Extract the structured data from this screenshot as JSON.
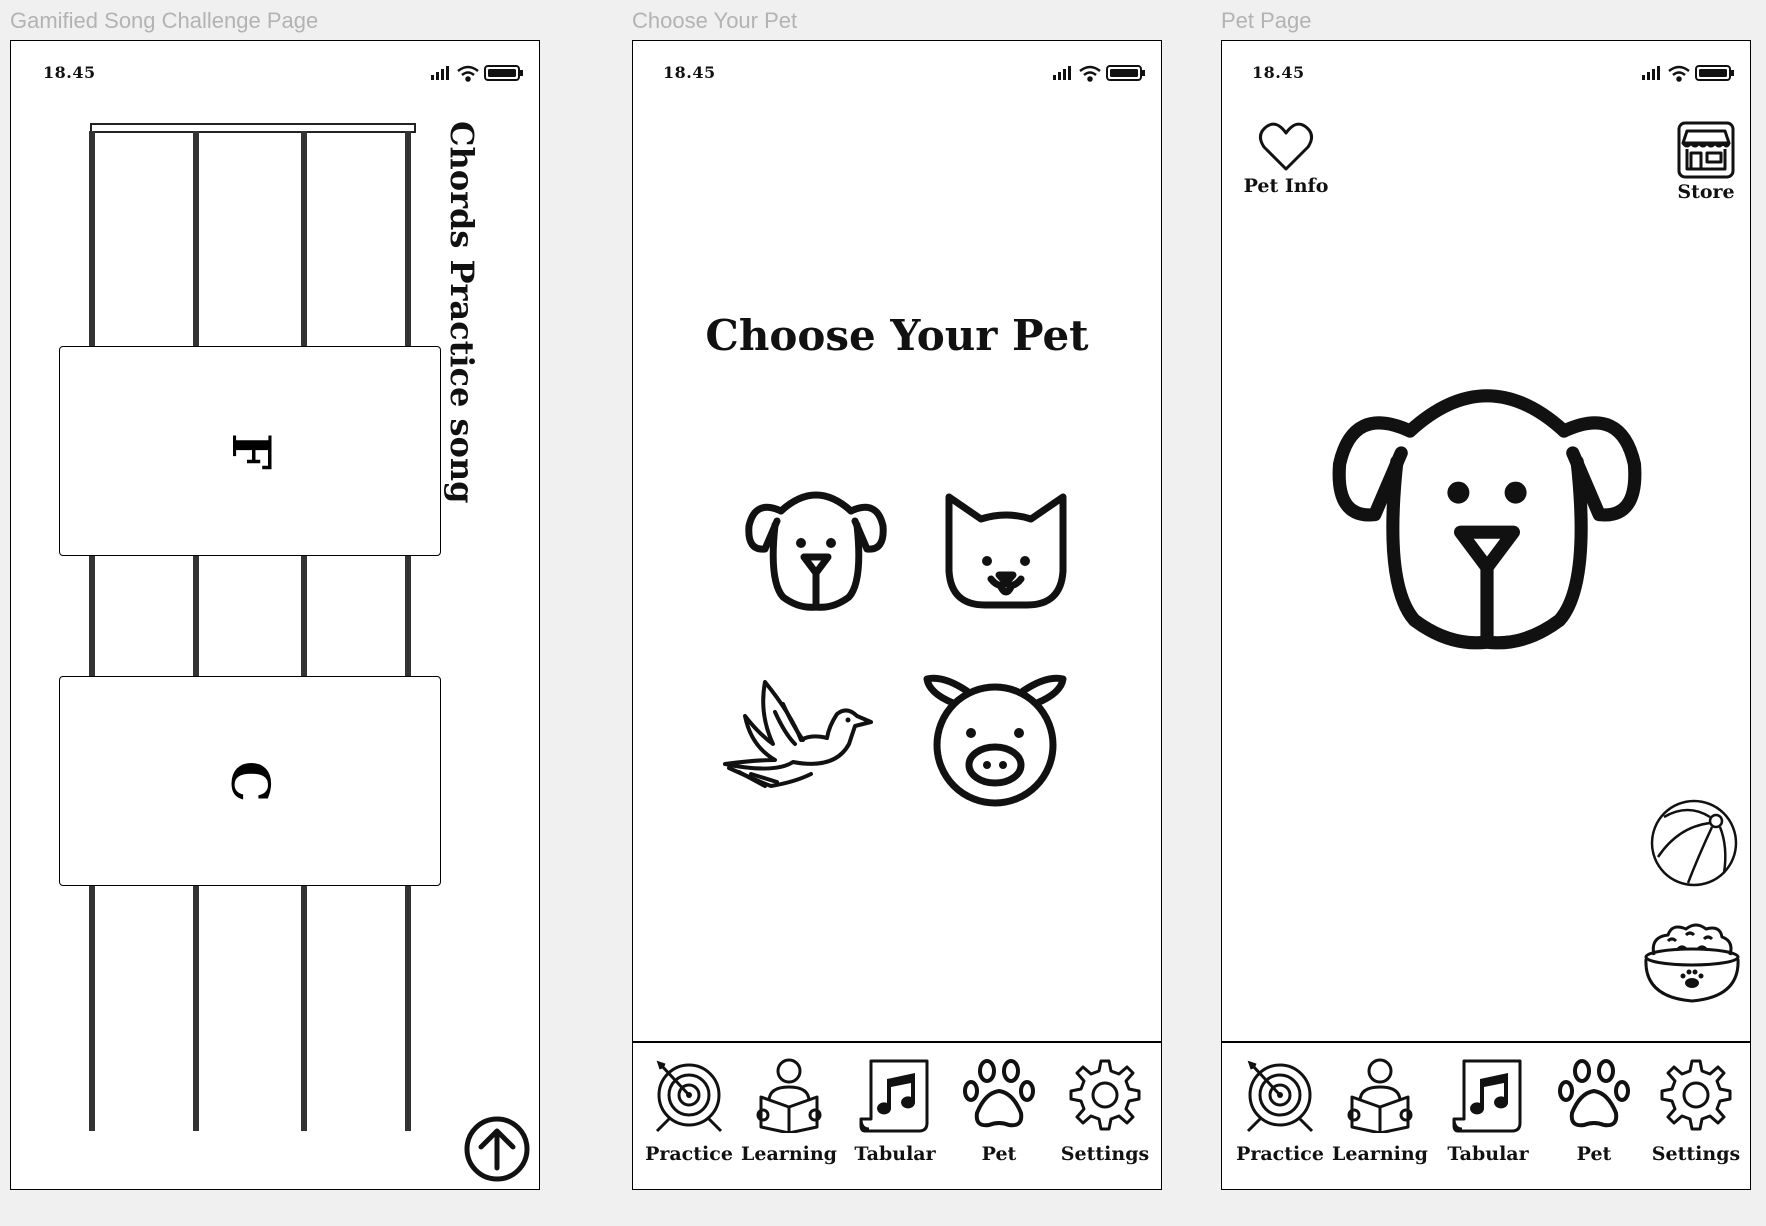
{
  "frames": [
    {
      "label": "Gamified Song Challenge Page"
    },
    {
      "label": "Choose Your Pet"
    },
    {
      "label": "Pet Page"
    }
  ],
  "status": {
    "time": "18.45"
  },
  "challenge": {
    "title": "Chords Practice song",
    "chords": [
      "F",
      "C"
    ],
    "up_icon": "arrow-up-circle-icon"
  },
  "choose": {
    "title": "Choose Your Pet",
    "pets": [
      "dog-icon",
      "cat-icon",
      "bird-icon",
      "pig-icon"
    ]
  },
  "petpage": {
    "pet_info_label": "Pet Info",
    "store_label": "Store",
    "items": [
      "ball-icon",
      "food-bowl-icon"
    ]
  },
  "nav": [
    {
      "label": "Practice",
      "icon": "target-icon"
    },
    {
      "label": "Learning",
      "icon": "reader-icon"
    },
    {
      "label": "Tabular",
      "icon": "music-sheet-icon"
    },
    {
      "label": "Pet",
      "icon": "paw-icon"
    },
    {
      "label": "Settings",
      "icon": "gear-icon"
    }
  ]
}
